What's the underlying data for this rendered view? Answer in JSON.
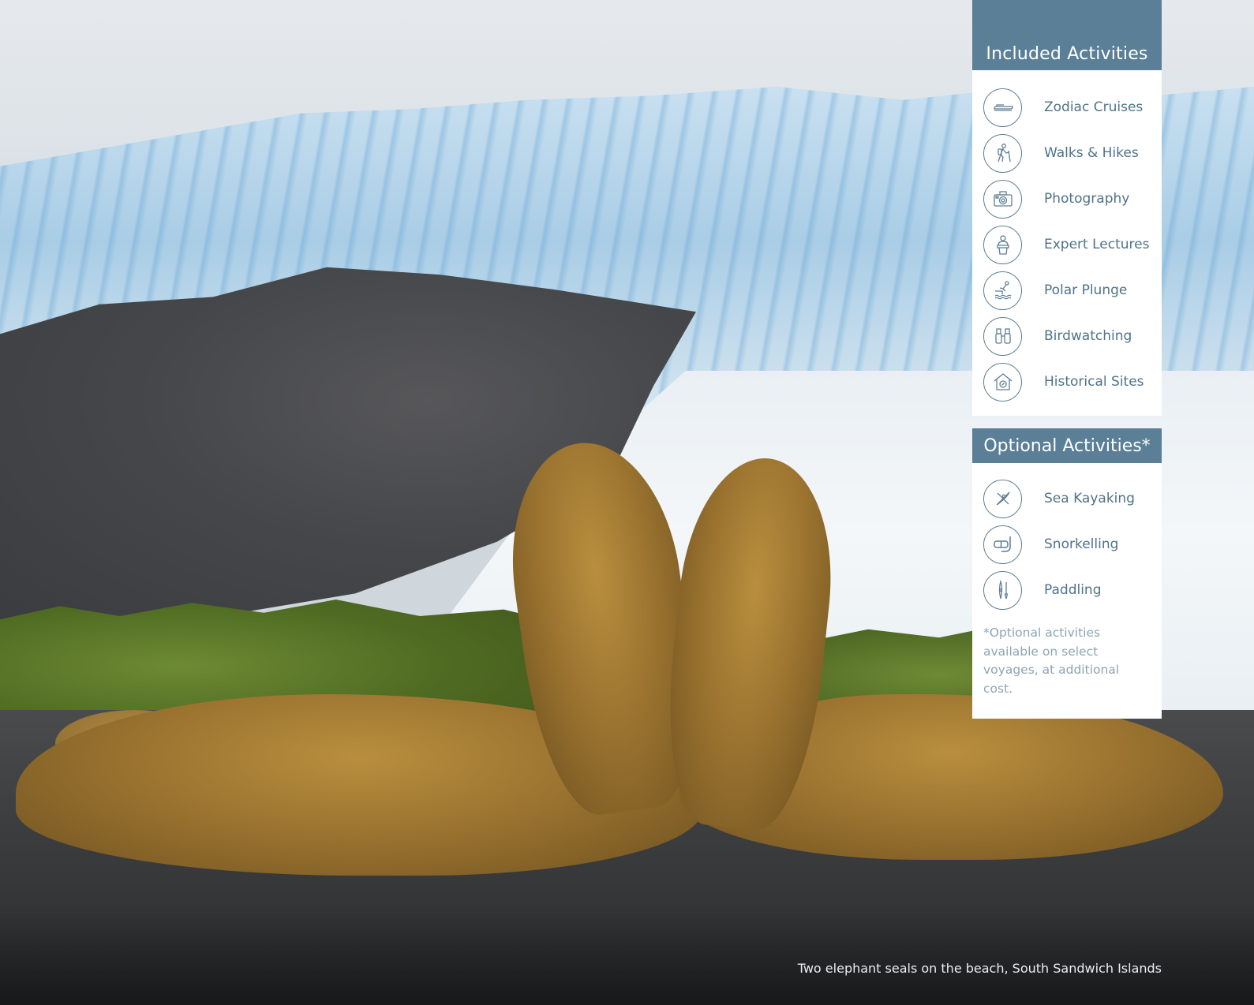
{
  "included": {
    "title": "Included Activities",
    "items": [
      {
        "label": "Zodiac Cruises",
        "icon": "zodiac-boat-icon"
      },
      {
        "label": "Walks & Hikes",
        "icon": "hiker-icon"
      },
      {
        "label": "Photography",
        "icon": "camera-icon"
      },
      {
        "label": "Expert Lectures",
        "icon": "lecturer-icon"
      },
      {
        "label": "Polar Plunge",
        "icon": "diver-icon"
      },
      {
        "label": "Birdwatching",
        "icon": "binoculars-icon"
      },
      {
        "label": "Historical Sites",
        "icon": "historic-house-icon"
      }
    ]
  },
  "optional": {
    "title": "Optional Activities*",
    "items": [
      {
        "label": "Sea Kayaking",
        "icon": "kayak-icon"
      },
      {
        "label": "Snorkelling",
        "icon": "snorkel-mask-icon"
      },
      {
        "label": "Paddling",
        "icon": "paddleboard-icon"
      }
    ],
    "footnote": "*Optional activities available on select voyages, at additional cost."
  },
  "caption": "Two elephant seals on the beach, South Sandwich Islands",
  "colors": {
    "header": "#5b7f96",
    "label": "#4f7389",
    "footnote": "#8ea4b3"
  }
}
